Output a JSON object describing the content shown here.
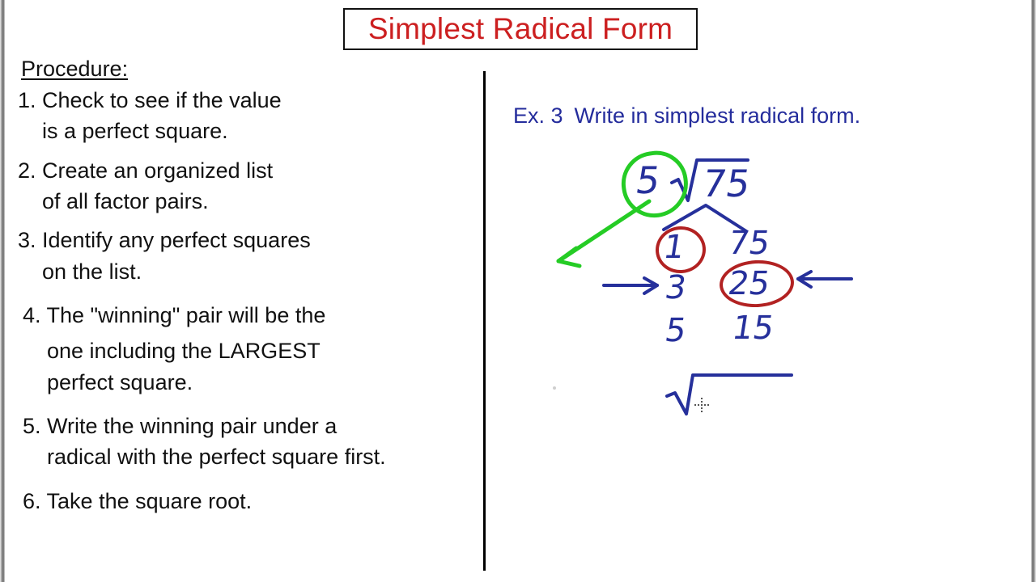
{
  "title": "Simplest Radical Form",
  "procedure": {
    "heading": "Procedure:",
    "steps": [
      {
        "line1": "1. Check to see if the value",
        "line2": "is a perfect square.",
        "line3": ""
      },
      {
        "line1": "2. Create an organized list",
        "line2": "of all factor pairs.",
        "line3": ""
      },
      {
        "line1": "3. Identify any perfect squares",
        "line2": "on the list.",
        "line3": ""
      },
      {
        "line1": "4. The \"winning\" pair will be the",
        "line2": "one including the LARGEST",
        "line3": "perfect square."
      },
      {
        "line1": "5. Write the winning pair under a",
        "line2": "radical with the perfect square first.",
        "line3": ""
      },
      {
        "line1": "6. Take the square root.",
        "line2": "",
        "line3": ""
      }
    ]
  },
  "example": {
    "label": "Ex. 3",
    "instruction": "Write in simplest radical form.",
    "expression": {
      "coefficient": "5",
      "radical_symbol": "√",
      "radicand": "75"
    },
    "factor_pairs": [
      {
        "left": "1",
        "right": "75"
      },
      {
        "left": "3",
        "right": "25"
      },
      {
        "left": "5",
        "right": "15"
      }
    ],
    "annotations": {
      "coefficient_circle_color": "#25cc25",
      "coefficient_arrow_color": "#25cc25",
      "factor_circle_color": "#b22222",
      "pointer_arrow_color": "#26309b",
      "circled_factors": [
        "1",
        "25"
      ],
      "arrow_to_three": "→",
      "arrow_to_twentyfive": "←"
    },
    "answer_radical": {
      "radical_symbol": "√",
      "radicand": ""
    }
  },
  "colors": {
    "title_red": "#cc1f20",
    "heading_blue": "#242c9c",
    "ink_blue": "#26309b",
    "highlight_green": "#25cc25",
    "circle_red": "#b22222",
    "text_black": "#111111",
    "board_white": "#ffffff"
  }
}
